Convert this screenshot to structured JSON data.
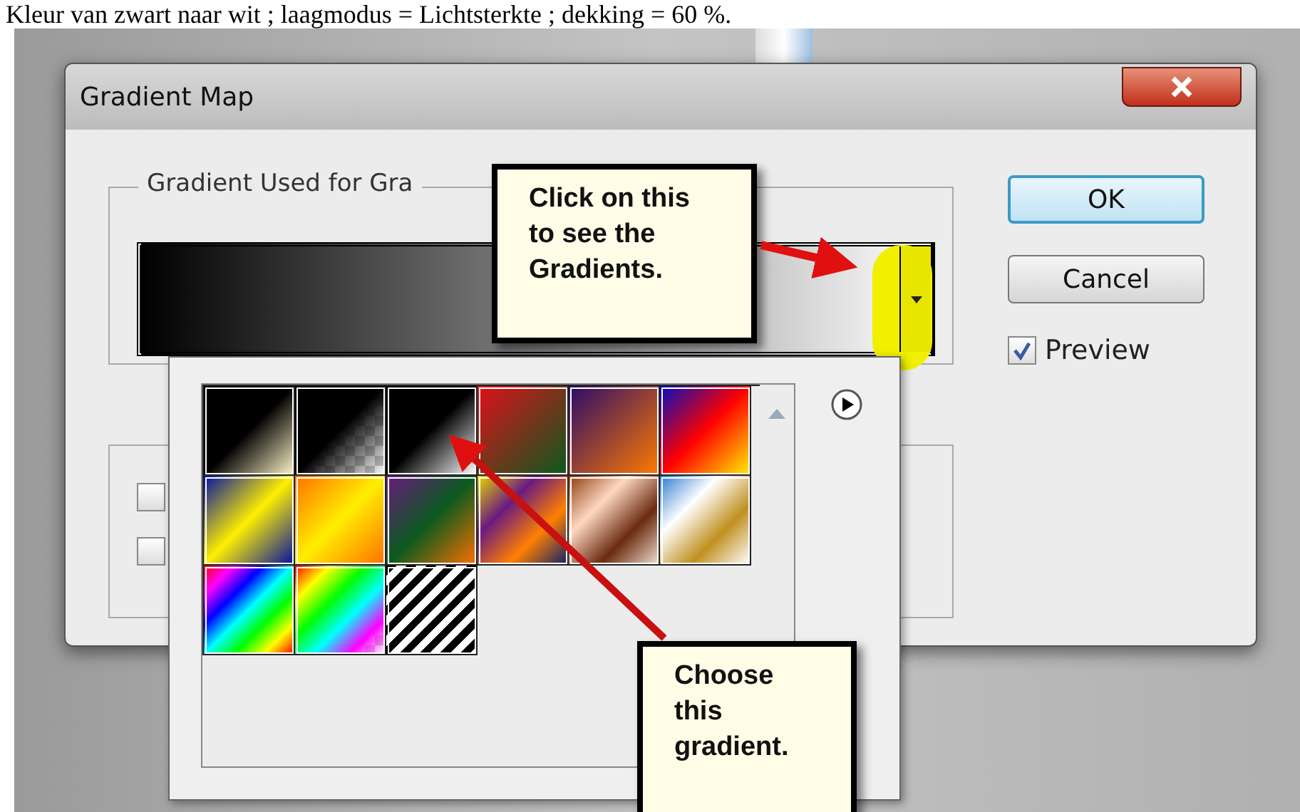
{
  "caption": "Kleur van zwart naar wit ; laagmodus = Lichtsterkte ; dekking = 60 %.",
  "window": {
    "title": "Gradient Map"
  },
  "gradient_group": {
    "legend": "Gradient Used for Gra"
  },
  "options_group": {
    "checkboxes": [
      {
        "checked": false
      },
      {
        "checked": false
      }
    ]
  },
  "buttons": [
    {
      "label": "OK",
      "default": true
    },
    {
      "label": "Cancel",
      "default": false
    }
  ],
  "preview": {
    "label": "Preview",
    "checked": true
  },
  "callouts": [
    {
      "lines": [
        "Click on this",
        "to see the",
        "Gradients."
      ]
    },
    {
      "lines": [
        "Choose",
        "this",
        "gradient."
      ]
    }
  ]
}
